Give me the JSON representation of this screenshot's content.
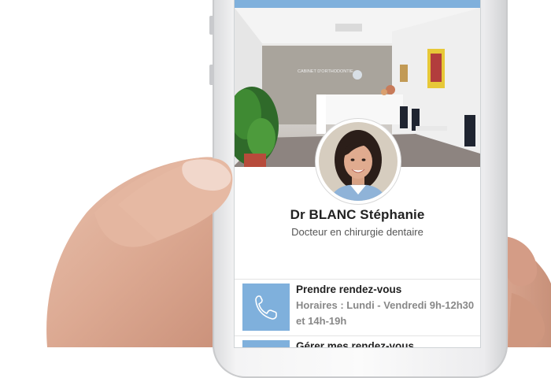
{
  "profile": {
    "name": "Dr BLANC Stéphanie",
    "specialty": "Docteur en chirurgie dentaire"
  },
  "hero": {
    "sign_line1": "CABINET D'ORTHODONTIE"
  },
  "actions": [
    {
      "title": "Prendre rendez-vous",
      "detail": "Horaires : Lundi - Vendredi 9h-12h30 et 14h-19h",
      "icon": "phone-icon"
    },
    {
      "title": "Gérer mes rendez-vous",
      "icon": "calendar-icon"
    }
  ],
  "colors": {
    "accent": "#7fb0dc"
  }
}
